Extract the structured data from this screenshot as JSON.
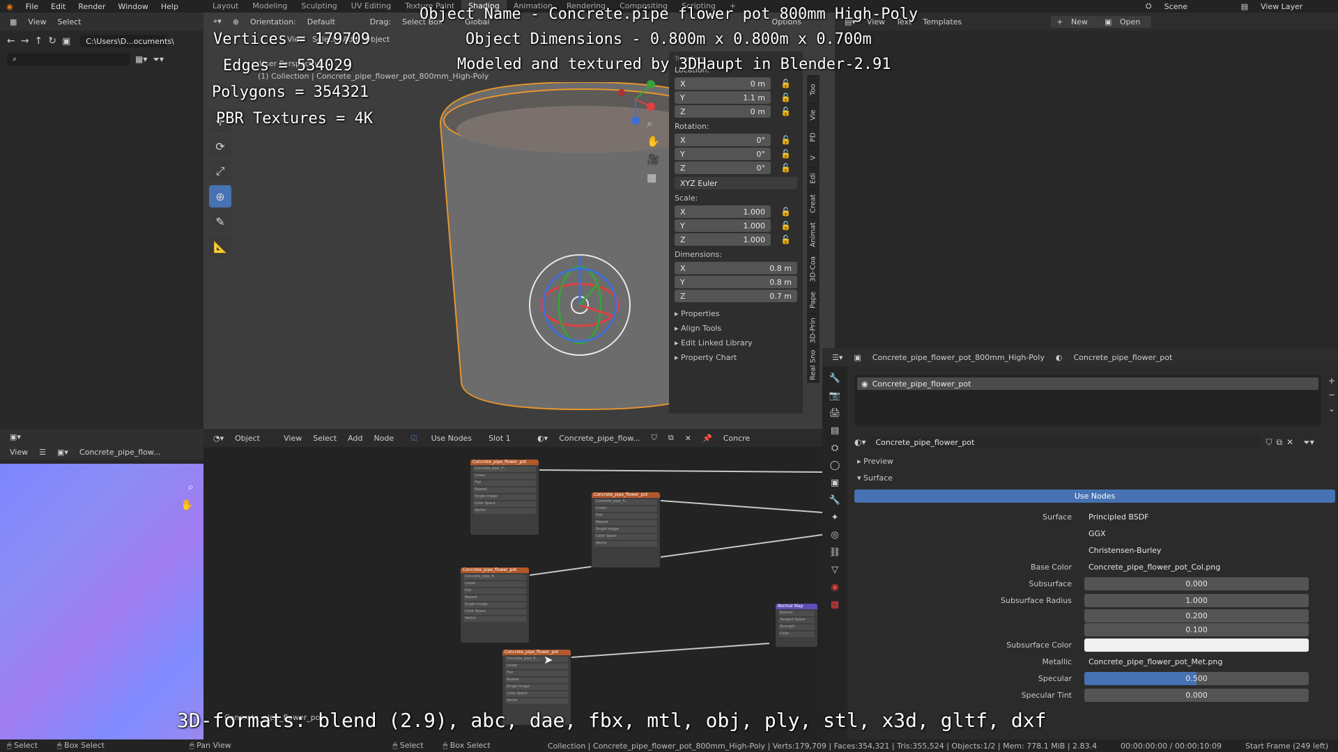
{
  "menubar": {
    "items": [
      "File",
      "Edit",
      "Render",
      "Window",
      "Help"
    ],
    "workspaces": [
      "Layout",
      "Modeling",
      "Sculpting",
      "UV Editing",
      "Texture Paint",
      "Shading",
      "Animation",
      "Rendering",
      "Compositing",
      "Scripting"
    ],
    "active_workspace": "Shading",
    "add_tab": "+",
    "scene": "Scene",
    "view_layer": "View Layer"
  },
  "file_browser": {
    "menu": [
      "View",
      "Select"
    ],
    "path": "C:\\Users\\D...ocuments\\"
  },
  "viewport_header": {
    "orientation_label": "Orientation:",
    "orientation_value": "Default",
    "drag_label": "Drag:",
    "drag_value": "Select Box",
    "transform_value": "Global",
    "options": "Options",
    "menus": [
      "View",
      "Select",
      "Add",
      "Object"
    ]
  },
  "viewport": {
    "view_name": "User Perspective",
    "collection": "(1) Collection | Concrete_pipe_flower_pot_800mm_High-Poly"
  },
  "overlay": {
    "object_name": "Object Name - Concrete.pipe flower pot 800mm High-Poly",
    "dimensions": "Object Dimensions - 0.800m x 0.800m x 0.700m",
    "credits": "Modeled and textured by 3DHaupt in Blender-2.91",
    "vertices": "Vertices = 179709",
    "edges": "Edges = 534029",
    "polygons": "Polygons = 354321",
    "textures": "PBR Textures = 4K",
    "formats": "3D-formats: blend (2.9), abc, dae, fbx, mtl, obj, ply, stl, x3d, gltf, dxf"
  },
  "n_panel": {
    "tab": "Transform",
    "location_label": "Location:",
    "location": [
      [
        "X",
        "0 m"
      ],
      [
        "Y",
        "1.1 m"
      ],
      [
        "Z",
        "0 m"
      ]
    ],
    "rotation_label": "Rotation:",
    "rotation": [
      [
        "X",
        "0°"
      ],
      [
        "Y",
        "0°"
      ],
      [
        "Z",
        "0°"
      ]
    ],
    "rotation_mode": "XYZ Euler",
    "scale_label": "Scale:",
    "scale": [
      [
        "X",
        "1.000"
      ],
      [
        "Y",
        "1.000"
      ],
      [
        "Z",
        "1.000"
      ]
    ],
    "dimensions_label": "Dimensions:",
    "dimensions": [
      [
        "X",
        "0.8 m"
      ],
      [
        "Y",
        "0.8 m"
      ],
      [
        "Z",
        "0.7 m"
      ]
    ],
    "collapsed": [
      "Properties",
      "Align Tools",
      "Edit Linked Library",
      "Property Chart"
    ],
    "vtabs": [
      "Too",
      "Vie",
      "PD",
      "V",
      "Edi",
      "Creat",
      "Animat",
      "3D-Coa",
      "Pape",
      "3D-Prin",
      "Real Sno"
    ]
  },
  "text_editor_header": {
    "menus": [
      "View",
      "Text",
      "Templates"
    ],
    "new": "New",
    "open": "Open"
  },
  "image_editor": {
    "view": "View",
    "image_name": "Concrete_pipe_flow..."
  },
  "node_editor": {
    "mode": "Object",
    "menus": [
      "View",
      "Select",
      "Add",
      "Node"
    ],
    "use_nodes": "Use Nodes",
    "slot": "Slot 1",
    "material": "Concrete_pipe_flow...",
    "material_short": "Concre",
    "footer_label": "Concrete_pipe_flower_pot",
    "node_title": "Concrete_pipe_flower_pot",
    "node_rows": [
      "Concrete_pipe_fl...",
      "Linear",
      "Flat",
      "Repeat",
      "Single Image",
      "Color Space",
      "Vector"
    ],
    "normal_map_title": "Normal Map",
    "normal_map_rows": [
      "Normal",
      "Tangent Space",
      "Strength",
      "Color"
    ]
  },
  "properties": {
    "breadcrumb_object": "Concrete_pipe_flower_pot_800mm_High-Poly",
    "breadcrumb_material": "Concrete_pipe_flower_pot",
    "material_slot": "Concrete_pipe_flower_pot",
    "material_name": "Concrete_pipe_flower_pot",
    "preview": "Preview",
    "surface_section": "Surface",
    "use_nodes_button": "Use Nodes",
    "rows": [
      {
        "label": "Surface",
        "value": "Principled BSDF"
      },
      {
        "label": "",
        "value": "GGX"
      },
      {
        "label": "",
        "value": "Christensen-Burley"
      },
      {
        "label": "Base Color",
        "value": "Concrete_pipe_flower_pot_Col.png"
      },
      {
        "label": "Subsurface",
        "value": "0.000"
      },
      {
        "label": "Subsurface Radius",
        "value": "1.000"
      },
      {
        "label": "",
        "value": "0.200"
      },
      {
        "label": "",
        "value": "0.100"
      },
      {
        "label": "Subsurface Color",
        "value": ""
      },
      {
        "label": "Metallic",
        "value": "Concrete_pipe_flower_pot_Met.png"
      },
      {
        "label": "Specular",
        "value": "0.500"
      },
      {
        "label": "Specular Tint",
        "value": "0.000"
      }
    ]
  },
  "statusbar": {
    "left": [
      "Select",
      "Box Select",
      "Pan View",
      "Select",
      "Box Select"
    ],
    "info": "Collection | Concrete_pipe_flower_pot_800mm_High-Poly | Verts:179,709 | Faces:354,321 | Tris:355,524 | Objects:1/2 | Mem: 778.1 MiB | 2.83.4",
    "time": "00:00:00:00 / 00:00:10:09",
    "frame": "Start Frame (249 left)"
  },
  "colors": {
    "active_blue": "#4772b3",
    "selection_orange": "#e8962e",
    "node_header": "#b2582a",
    "normal_map_purple": "#8f7fe6"
  }
}
